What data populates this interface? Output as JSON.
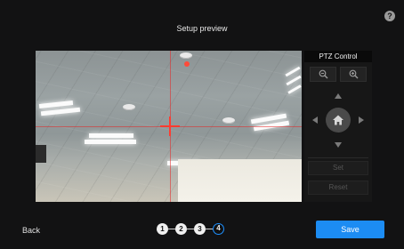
{
  "header": {
    "title": "Setup preview",
    "help_icon": "help-icon",
    "help_glyph": "?"
  },
  "ptz": {
    "title": "PTZ Control",
    "zoom_out_icon": "zoom-out-icon",
    "zoom_in_icon": "zoom-in-icon",
    "up_icon": "arrow-up-icon",
    "down_icon": "arrow-down-icon",
    "left_icon": "arrow-left-icon",
    "right_icon": "arrow-right-icon",
    "home_icon": "home-icon",
    "set_label": "Set",
    "reset_label": "Reset"
  },
  "footer": {
    "back_label": "Back",
    "steps": [
      "1",
      "2",
      "3",
      "4"
    ],
    "current_step": 4,
    "save_label": "Save"
  },
  "colors": {
    "accent": "#1c8cf3",
    "crosshair": "#ff3b30",
    "background": "#121213"
  }
}
